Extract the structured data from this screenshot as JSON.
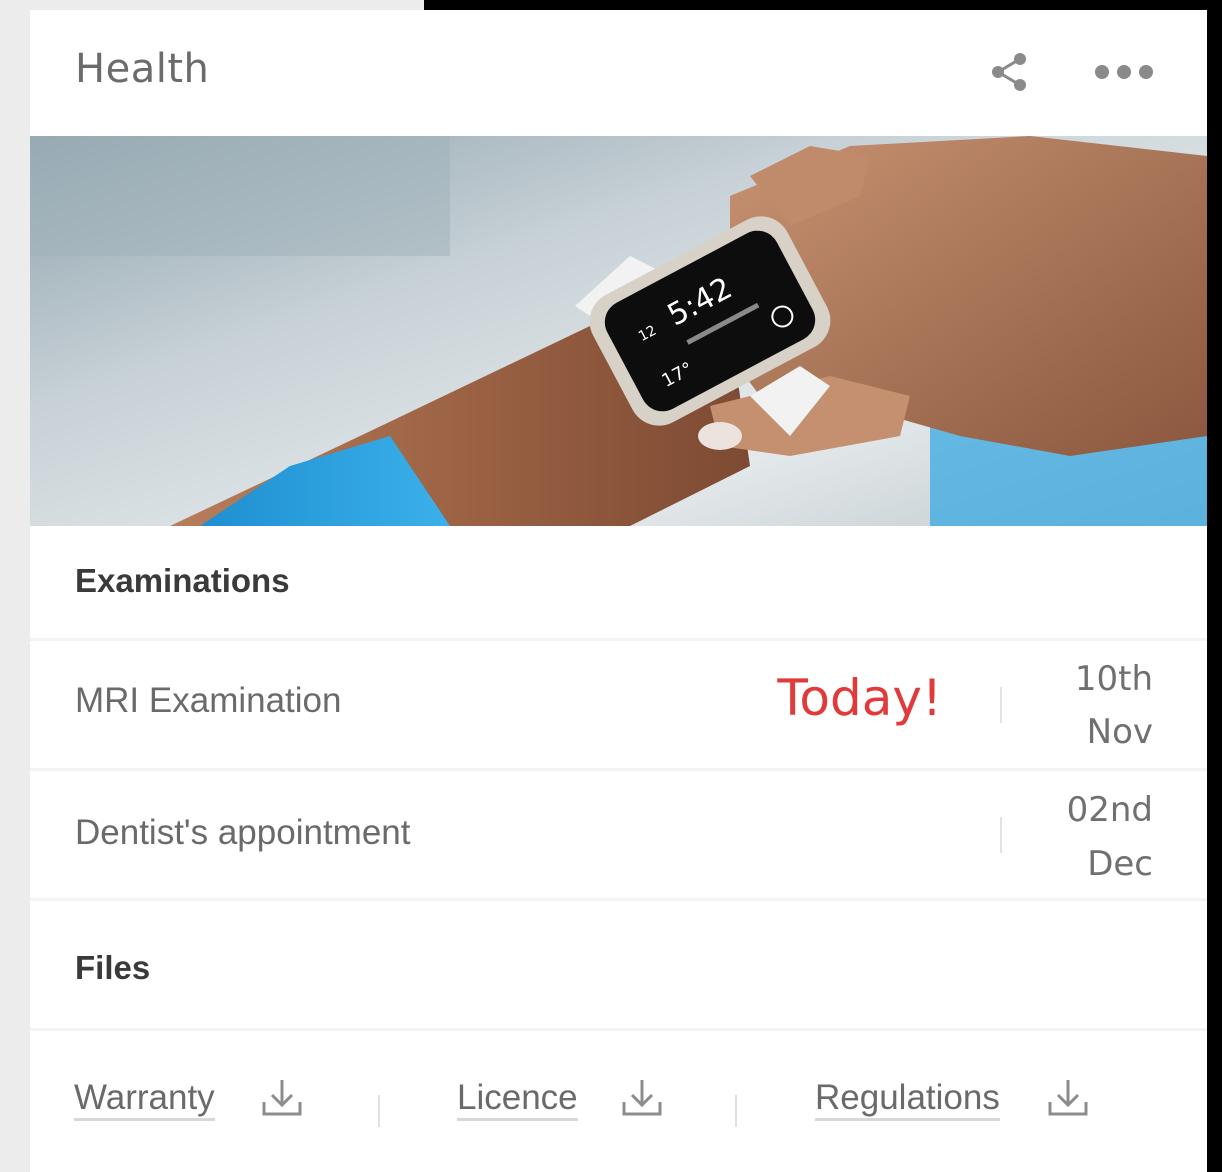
{
  "card": {
    "title": "Health",
    "header_icons": [
      "share-icon",
      "more-horizontal-icon"
    ]
  },
  "hero_image": {
    "watch": {
      "time": "5:42",
      "hour_hand": "12",
      "temperature": "17°"
    },
    "icon": "smartwatch-photo"
  },
  "examinations": {
    "heading": "Examinations",
    "items": [
      {
        "label": "MRI Examination",
        "badge": "Today!",
        "day": "10th",
        "month": "Nov"
      },
      {
        "label": "Dentist's appointment",
        "badge": "",
        "day": "02nd",
        "month": "Dec"
      }
    ]
  },
  "files": {
    "heading": "Files",
    "items": [
      {
        "label": "Warranty",
        "icon": "download-icon"
      },
      {
        "label": "Licence",
        "icon": "download-icon"
      },
      {
        "label": "Regulations",
        "icon": "download-icon"
      }
    ]
  },
  "colors": {
    "accent_red": "#e03a3a",
    "text_gray": "#6a6a6a",
    "heading_dark": "#3a3a3a",
    "background_dark": "#000000",
    "page_gray": "#ececec"
  }
}
